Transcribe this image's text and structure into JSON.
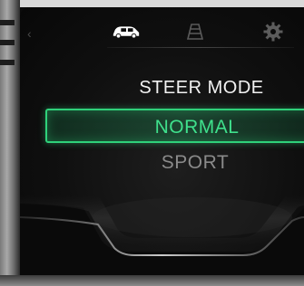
{
  "top_bar": {
    "back_icon": "chevron-left-icon",
    "tabs": [
      {
        "icon": "car-icon",
        "active": true
      },
      {
        "icon": "road-icon",
        "active": false
      },
      {
        "icon": "gear-icon",
        "active": false
      }
    ]
  },
  "menu": {
    "title": "STEER MODE",
    "options": [
      {
        "label": "NORMAL",
        "selected": true
      },
      {
        "label": "SPORT",
        "selected": false
      }
    ]
  },
  "colors": {
    "accent": "#2fd17a",
    "selected_text": "#3fe08c",
    "title_text": "#f2f2f2",
    "inactive_text": "#8a8a8a",
    "background": "#0b0b0b"
  }
}
